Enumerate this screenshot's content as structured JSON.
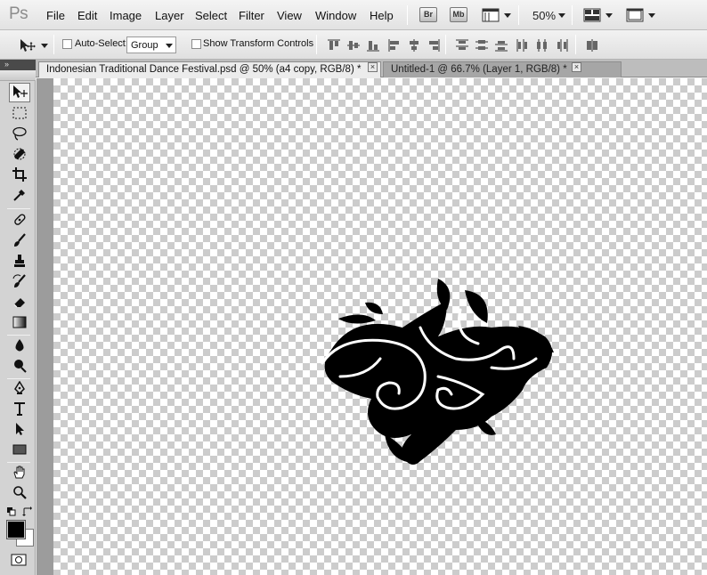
{
  "app": {
    "logo": "Ps"
  },
  "menu": [
    "File",
    "Edit",
    "Image",
    "Layer",
    "Select",
    "Filter",
    "View",
    "Window",
    "Help"
  ],
  "app_bar": {
    "bridge": "Br",
    "mini_bridge": "Mb",
    "zoom": "50%"
  },
  "options": {
    "auto_select_label": "Auto-Select:",
    "auto_select_checked": false,
    "auto_select_value": "Group",
    "show_transform_label": "Show Transform Controls",
    "show_transform_checked": false
  },
  "tabs": [
    {
      "title": "Indonesian Traditional Dance Festival.psd @ 50% (a4 copy, RGB/8) *",
      "active": true
    },
    {
      "title": "Untitled-1 @ 66.7% (Layer 1, RGB/8) *",
      "active": false
    }
  ],
  "tools": [
    "move",
    "marquee",
    "lasso",
    "quick-selection",
    "crop",
    "eyedropper",
    "spot-healing",
    "brush",
    "clone-stamp",
    "history-brush",
    "eraser",
    "gradient",
    "blur",
    "dodge",
    "pen",
    "type",
    "path-selection",
    "rectangle",
    "hand",
    "zoom"
  ],
  "colors": {
    "foreground": "#000000",
    "background": "#ffffff"
  },
  "icons": {
    "panel_collapse": "double-chevron-right-icon"
  }
}
